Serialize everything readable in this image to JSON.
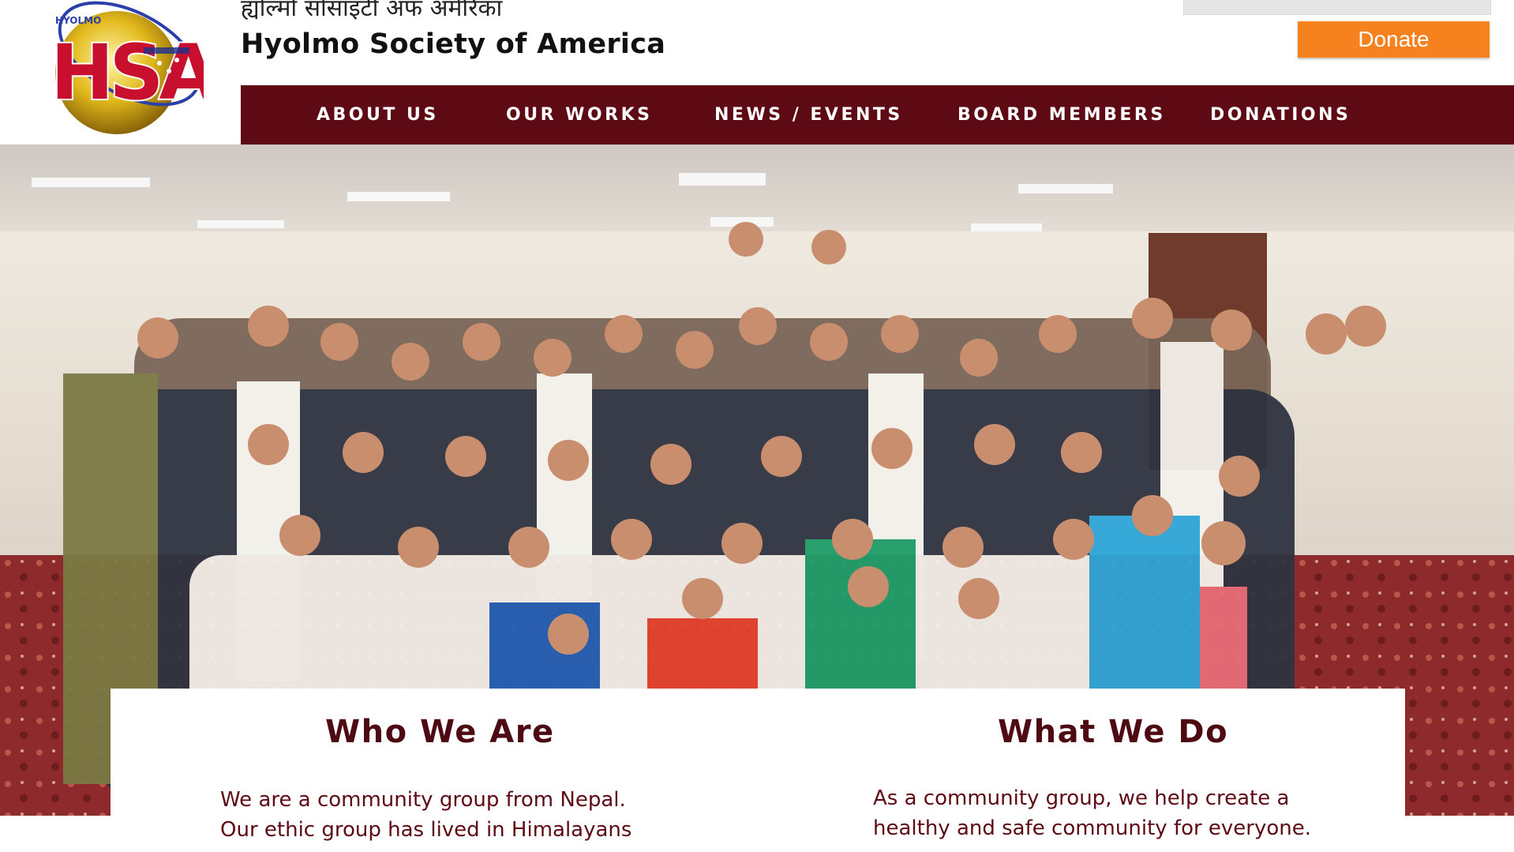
{
  "header": {
    "title_nepali": "ह्योल्मो सोसाइटी अफ अमेरिका",
    "title_english": "Hyolmo Society of America",
    "logo": {
      "top_text": "HYOLMO",
      "letters": "HSA"
    },
    "donate_label": "Donate"
  },
  "nav": {
    "items": [
      {
        "label": "ABOUT US"
      },
      {
        "label": "OUR WORKS"
      },
      {
        "label": "NEWS / EVENTS"
      },
      {
        "label": "BOARD MEMBERS"
      },
      {
        "label": "DONATIONS"
      }
    ]
  },
  "sections": {
    "who": {
      "heading": "Who We Are",
      "body": "We are a community group from Nepal.\nOur ethic group has lived in Himalayans"
    },
    "what": {
      "heading": "What We Do",
      "body": "As a community group, we help create a\nhealthy and safe community for everyone."
    }
  },
  "colors": {
    "nav_bg": "#5e0a14",
    "heading": "#4e0a12",
    "donate": "#f5821f"
  }
}
